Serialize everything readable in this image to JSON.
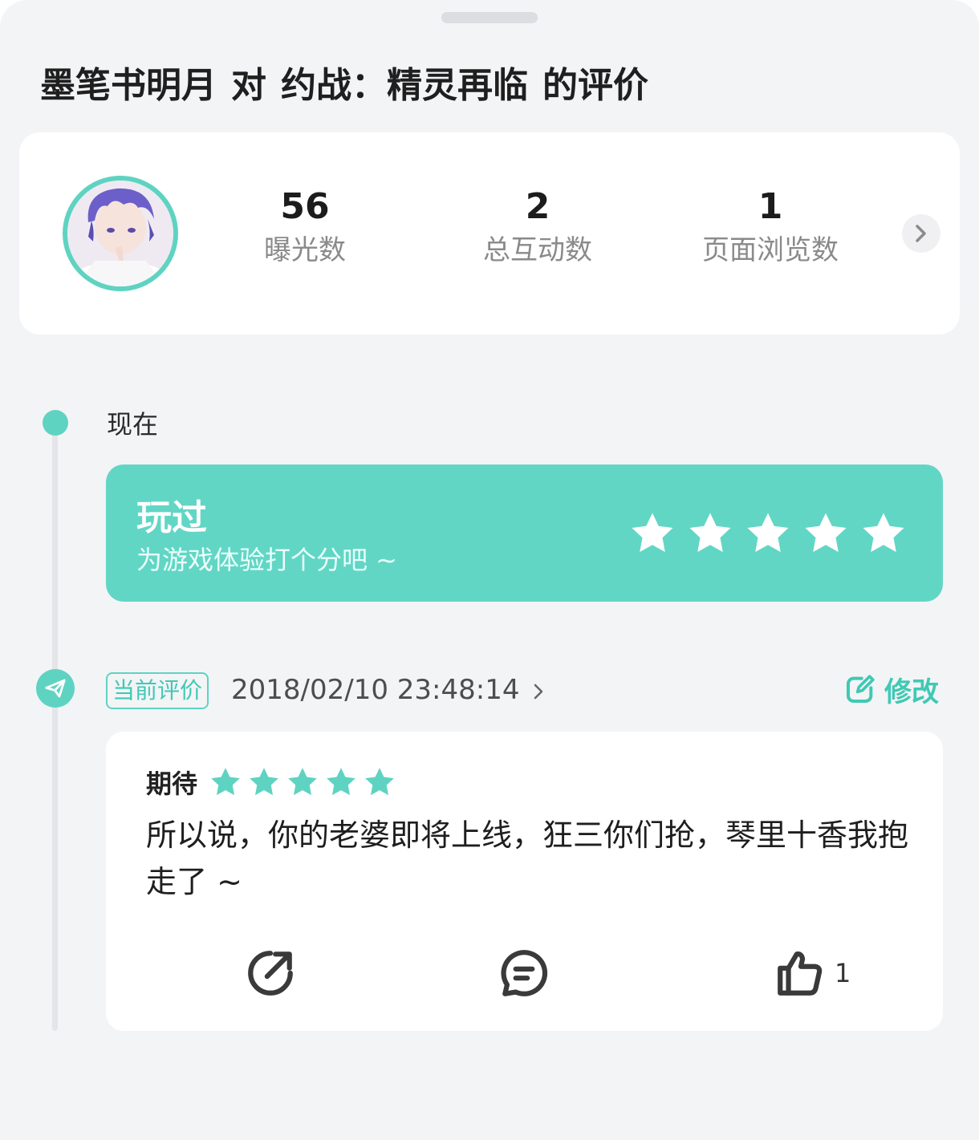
{
  "header": {
    "user": "墨笔书明月",
    "connector": "对",
    "game": "约战：精灵再临",
    "suffix": "的评价"
  },
  "stats": [
    {
      "value": "56",
      "label": "曝光数"
    },
    {
      "value": "2",
      "label": "总互动数"
    },
    {
      "value": "1",
      "label": "页面浏览数"
    }
  ],
  "timeline": {
    "now_label": "现在"
  },
  "played": {
    "title": "玩过",
    "subtitle": "为游戏体验打个分吧 ~",
    "stars": 5
  },
  "current_review": {
    "badge": "当前评价",
    "date": "2018/02/10 23:48:14",
    "edit_label": "修改",
    "rating_label": "期待",
    "rating": 5,
    "text": "所以说，你的老婆即将上线，狂三你们抢，琴里十香我抱走了 ~",
    "likes": "1"
  },
  "colors": {
    "accent": "#5fd3c2",
    "card_accent": "#62d6c5",
    "background": "#f3f4f6"
  },
  "icons": [
    "chevron-right-icon",
    "paper-plane-icon",
    "star-icon",
    "edit-icon",
    "share-icon",
    "comment-icon",
    "thumbs-up-icon"
  ]
}
